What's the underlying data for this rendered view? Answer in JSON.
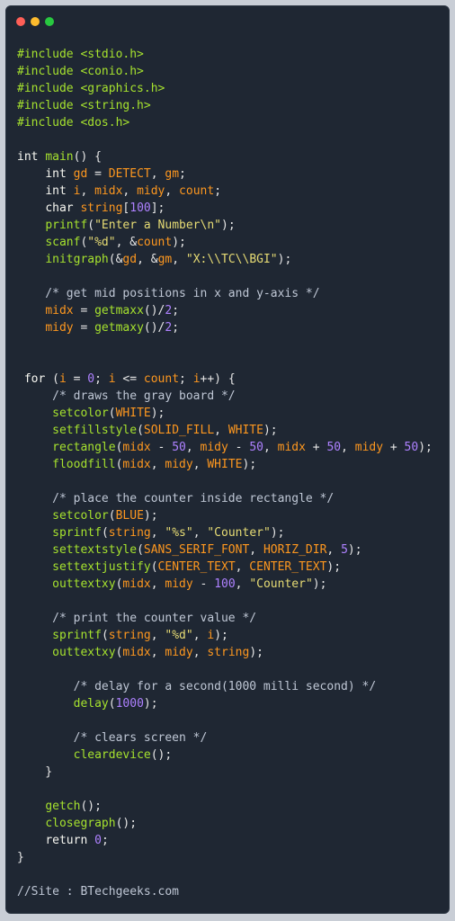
{
  "window": {
    "buttons": {
      "close_color": "#ff5f57",
      "minimize_color": "#febc2e",
      "maximize_color": "#28c840"
    }
  },
  "code_lines": [
    "#include <stdio.h>",
    "#include <conio.h>",
    "#include <graphics.h>",
    "#include <string.h>",
    "#include <dos.h>",
    "",
    "int main() {",
    "    int gd = DETECT, gm;",
    "    int i, midx, midy, count;",
    "    char string[100];",
    "    printf(\"Enter a Number\\n\");",
    "    scanf(\"%d\", &count);",
    "    initgraph(&gd, &gm, \"X:\\\\TC\\\\BGI\");",
    "",
    "    /* get mid positions in x and y-axis */",
    "    midx = getmaxx()/2;",
    "    midy = getmaxy()/2;",
    "",
    "",
    " for (i = 0; i <= count; i++) {",
    "     /* draws the gray board */",
    "     setcolor(WHITE);",
    "     setfillstyle(SOLID_FILL, WHITE);",
    "     rectangle(midx - 50, midy - 50, midx + 50, midy + 50);",
    "     floodfill(midx, midy, WHITE);",
    "",
    "     /* place the counter inside rectangle */",
    "     setcolor(BLUE);",
    "     sprintf(string, \"%s\", \"Counter\");",
    "     settextstyle(SANS_SERIF_FONT, HORIZ_DIR, 5);",
    "     settextjustify(CENTER_TEXT, CENTER_TEXT);",
    "     outtextxy(midx, midy - 100, \"Counter\");",
    "",
    "     /* print the counter value */",
    "     sprintf(string, \"%d\", i);",
    "     outtextxy(midx, midy, string);",
    "",
    "        /* delay for a second(1000 milli second) */",
    "        delay(1000);",
    "",
    "        /* clears screen */",
    "        cleardevice();",
    "    }",
    "",
    "    getch();",
    "    closegraph();",
    "    return 0;",
    "}",
    "",
    "//Site : BTechgeeks.com"
  ]
}
